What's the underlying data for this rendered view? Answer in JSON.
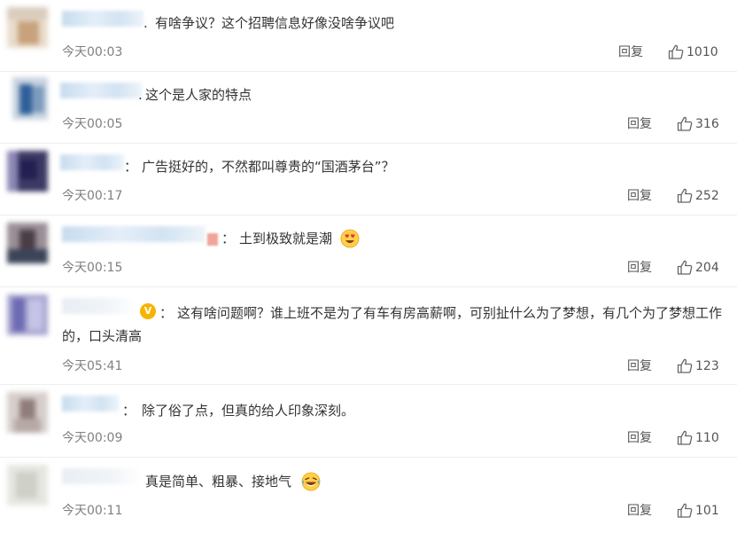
{
  "actions": {
    "reply_label": "回复"
  },
  "icons": {
    "like": "thumbs-up-outline-icon",
    "verified": "verified-v-badge-icon"
  },
  "comments": [
    {
      "sep": ".",
      "text": "有啥争议？这个招聘信息好像没啥争议吧",
      "time": "今天00:03",
      "likes": "1010"
    },
    {
      "sep": ".",
      "text": "这个是人家的特点",
      "time": "今天00:05",
      "likes": "316"
    },
    {
      "sep": "：",
      "text": "广告挺好的，不然都叫尊贵的“国酒茅台”？",
      "time": "今天00:17",
      "likes": "252"
    },
    {
      "sep": "：",
      "text": "土到极致就是潮",
      "emoji": "heart-eyes-emoji",
      "time": "今天00:15",
      "likes": "204"
    },
    {
      "sep": "：",
      "badge": "V",
      "text": "这有啥问题啊？谁上班不是为了有车有房高薪啊，可别扯什么为了梦想，有几个为了梦想工作的，口头清高",
      "time": "今天05:41",
      "likes": "123"
    },
    {
      "sep": "：",
      "text": "除了俗了点，但真的给人印象深刻。",
      "time": "今天00:09",
      "likes": "110"
    },
    {
      "sep": "",
      "text": "真是简单、粗暴、接地气",
      "emoji": "laughing-tears-emoji",
      "time": "今天00:11",
      "likes": "101"
    }
  ]
}
